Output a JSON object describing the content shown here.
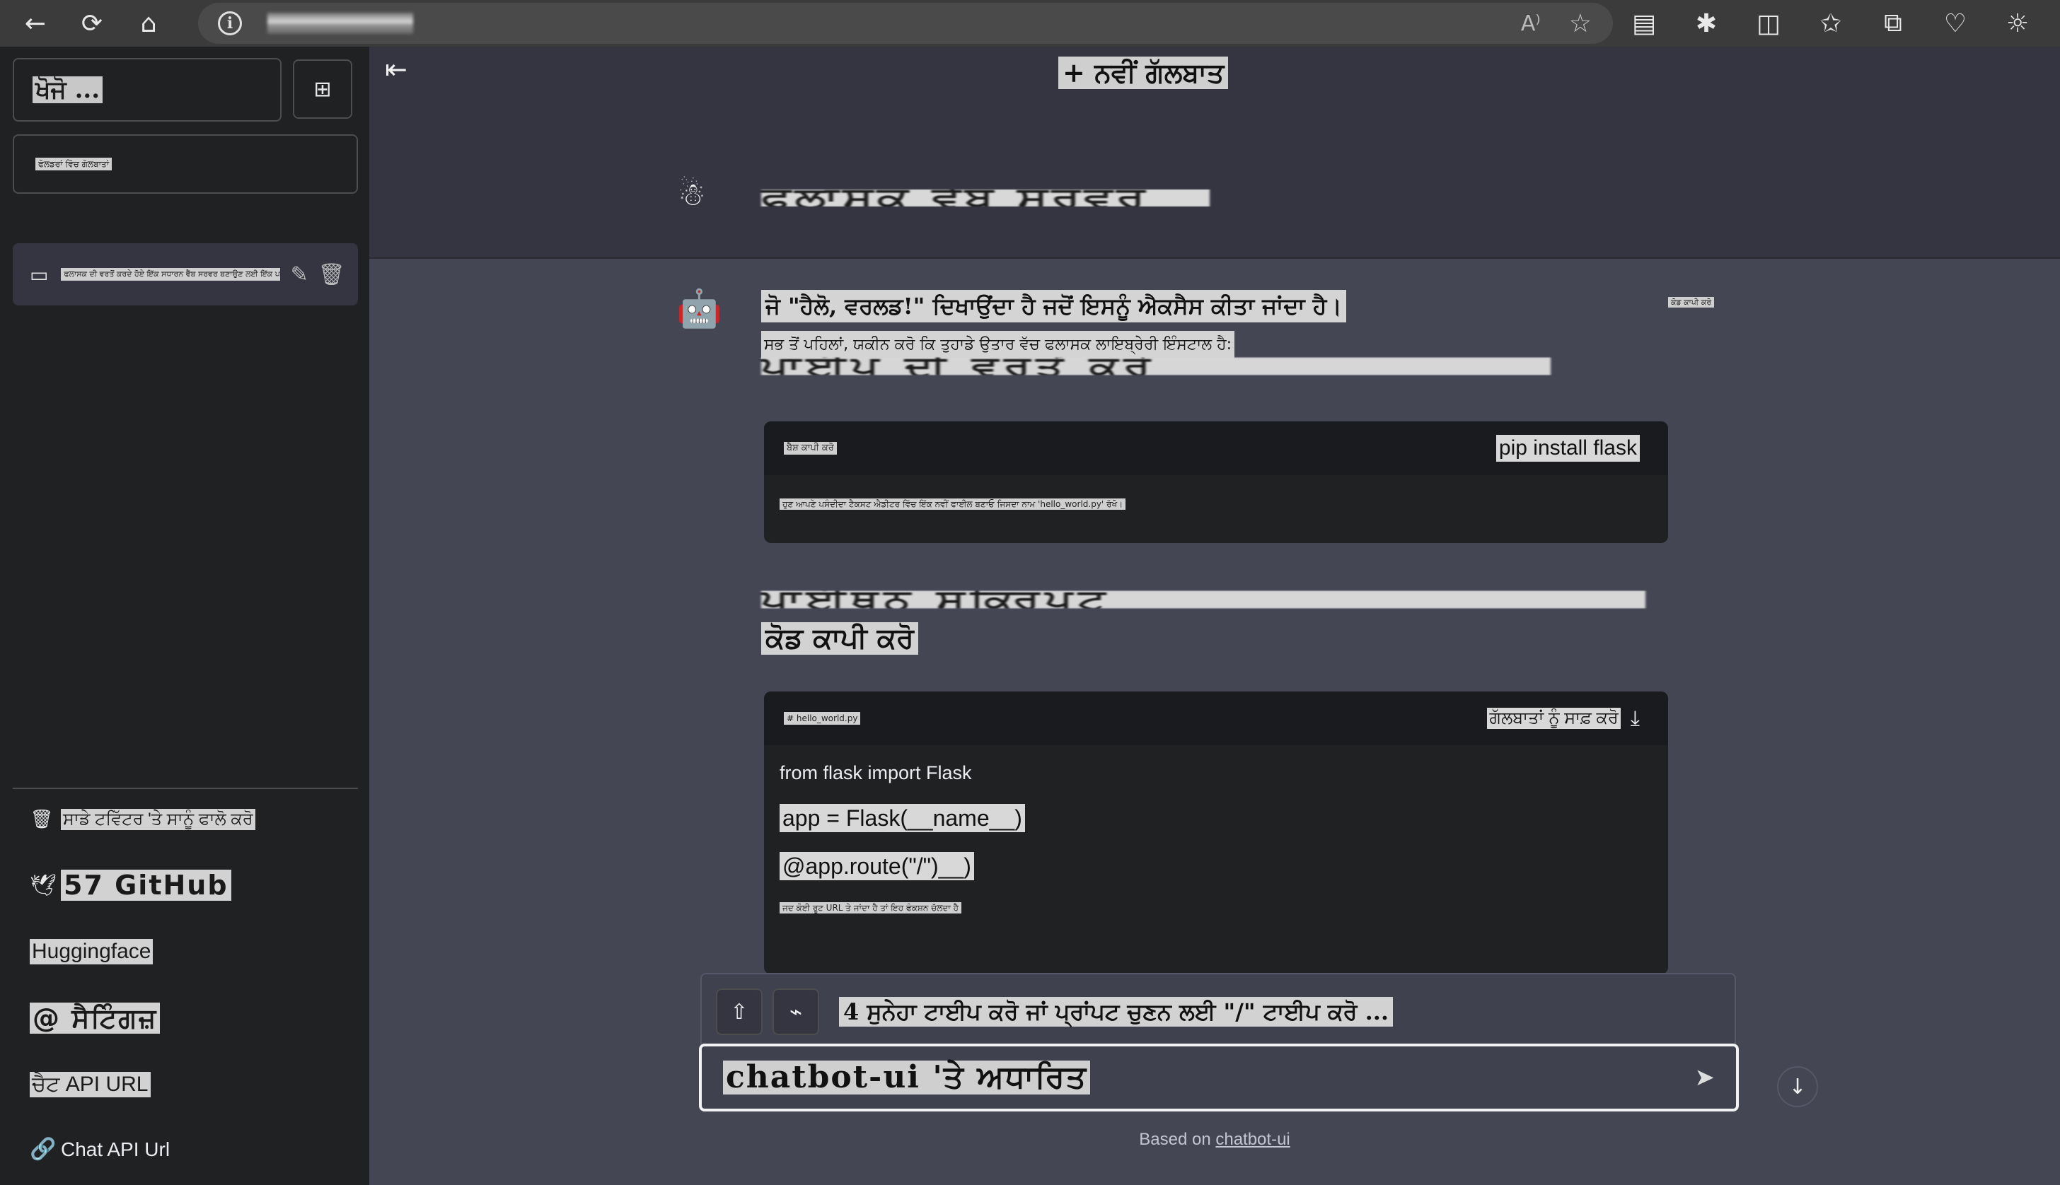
{
  "browser": {
    "back": "←",
    "reload": "⟳",
    "home": "⌂",
    "info": "i",
    "read_aloud": "A⁾",
    "favorite": "☆",
    "tools": [
      "▤",
      "✱",
      "◫",
      "✩",
      "⧉",
      "♡",
      "☼"
    ]
  },
  "sidebar": {
    "search_placeholder": "ਖੋਜੋ ...",
    "new_folder_icon": "⊞",
    "folder_label": "ਫੋਲਡਰਾਂ ਵਿੱਚ ਗੱਲਬਾਤਾਂ",
    "conversation": "ਫਲਾਸਕ ਦੀ ਵਰਤੋਂ ਕਰਦੇ ਹੋਏ ਇੱਕ ਸਧਾਰਨ ਵੈੱਬ ਸਰਵਰ ਬਣਾਉਣ ਲਈ ਇੱਕ ਪਾਈਥਨ ਸਕ੍ਰਿਪਟ",
    "links": {
      "twitter": "ਸਾਡੇ ਟਵਿੱਟਰ 'ਤੇ ਸਾਨੂੰ ਫਾਲੋ ਕਰੋ",
      "github": "57 GitHub",
      "huggingface": "Huggingface",
      "settings": "@ ਸੈਟਿੰਗਜ਼",
      "chat_api_url_pa": "ਚੈਟ API URL",
      "chat_api_url": "Chat API Url"
    }
  },
  "main": {
    "collapse_icon": "⇤",
    "new_chat": "+ ਨਵੀਂ ਗੱਲਬਾਤ",
    "user_message": "ਫਲਾਸਕ ਵੈੱਬ ਸਰਵਰ",
    "bot": {
      "line1": "ਜੋ \"ਹੈਲੋ, ਵਰਲਡ!\" ਦਿਖਾਉਂਦਾ ਹੈ ਜਦੋਂ ਇਸਨੂੰ ਐਕਸੈਸ ਕੀਤਾ ਜਾਂਦਾ ਹੈ।",
      "side_note": "ਕੋਡ ਕਾਪੀ ਕਰੋ",
      "line2": "ਸਭ ਤੋਂ ਪਹਿਲਾਂ, ਯਕੀਨ ਕਰੋ ਕਿ ਤੁਹਾਡੇ ਉਤਾਰ ਵੱਚ ਫਲਾਸਕ ਲਾਇਬ੍ਰੇਰੀ ਇੰਸਟਾਲ ਹੈ:",
      "heading1": "ਪਾਈਪ ਦੀ ਵਰਤੋਂ ਕਰੋ",
      "code1": {
        "lang": "ਬੈਸ਼ ਕਾਪੀ ਕਰੋ",
        "command": "pip install flask",
        "note": "ਹੁਣ ਆਪਣੇ ਪਸੰਦੀਦਾ ਟੈਕਸਟ ਐਡੀਟਰ ਵਿੱਚ ਇੱਕ ਨਵੀਂ ਫਾਈਲ ਬਣਾਓ ਜਿਸਦਾ ਨਾਮ 'hello_world.py' ਰੱਖੋ।"
      },
      "heading2": "ਪਾਈਥਨ ਸਕ੍ਰਿਪਟ",
      "copy_code": "ਕੋਡ ਕਾਪੀ ਕਰੋ",
      "code2": {
        "filename": "# hello_world.py",
        "clear": "ਗੱਲਬਾਤਾਂ ਨੂੰ ਸਾਫ਼ ਕਰੋ",
        "line1": "from flask import Flask",
        "line2": "app = Flask(__name__)",
        "line3": "@app.route(\"/\")__)",
        "line4": "ਜਦ ਕੋਈ ਰੂਟ URL ਤੇ ਜਾਂਦਾ ਹੈ ਤਾਂ ਇਹ ਫੰਕਸ਼ਨ ਚੱਲਦਾ ਹੈ"
      }
    },
    "prompt_hint": "4 ਸੁਨੇਹਾ ਟਾਈਪ ਕਰੋ ਜਾਂ ਪ੍ਰਾਂਪਟ ਚੁਣਨ ਲਈ \"/\" ਟਾਈਪ ਕਰੋ ...",
    "input_placeholder": "chatbot-ui 'ਤੇ ਅਧਾਰਿਤ",
    "footer_prefix": "Based on ",
    "footer_link": "chatbot-ui"
  }
}
